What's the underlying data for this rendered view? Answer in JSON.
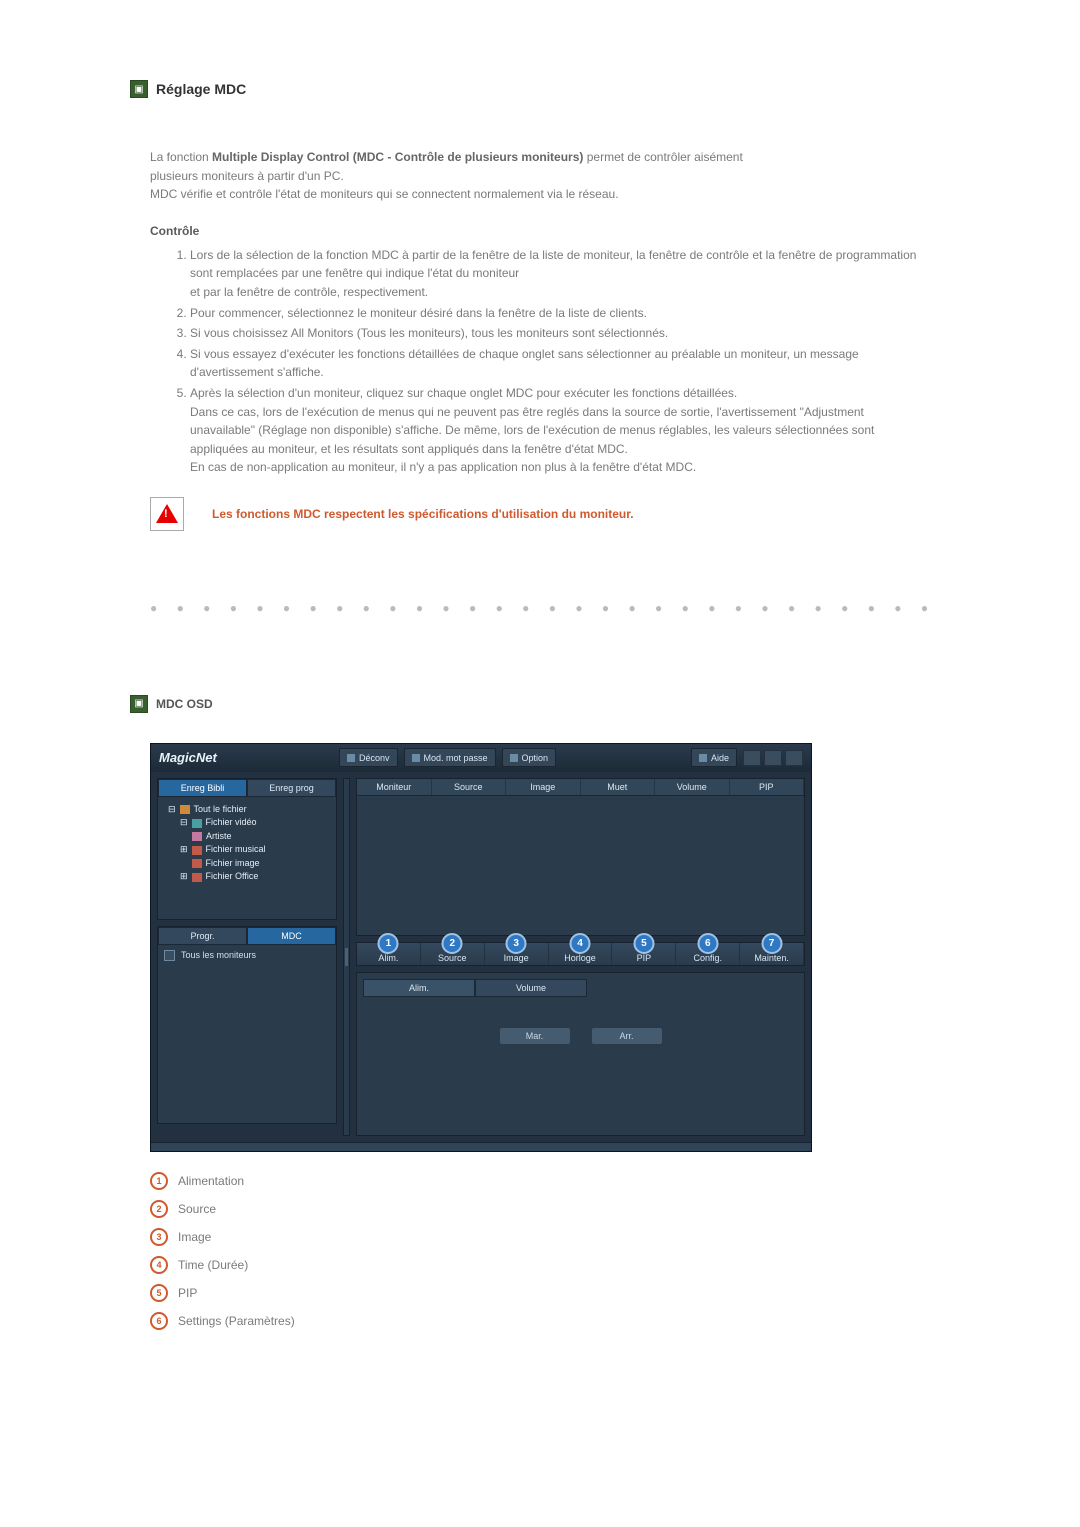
{
  "header": {
    "title": "Réglage MDC"
  },
  "intro": {
    "prefix": "La fonction ",
    "bold": "Multiple Display Control (MDC - Contrôle de plusieurs moniteurs)",
    "suffix": " permet de contrôler aisément",
    "line2": "plusieurs moniteurs à partir d'un PC.",
    "line3": "MDC vérifie et contrôle l'état de moniteurs qui se connectent normalement via le réseau."
  },
  "controle": {
    "heading": "Contrôle",
    "items": [
      "Lors de la sélection de la fonction MDC à partir de la fenêtre de la liste de moniteur, la fenêtre de contrôle et la fenêtre de programmation sont remplacées par une fenêtre qui indique l'état du moniteur\net par la fenêtre de contrôle, respectivement.",
      "Pour commencer, sélectionnez le moniteur désiré dans la fenêtre de la liste de clients.",
      "Si vous choisissez All Monitors (Tous les moniteurs), tous les moniteurs sont sélectionnés.",
      "Si vous essayez d'exécuter les fonctions détaillées de chaque onglet sans sélectionner au préalable un moniteur, un message d'avertissement s'affiche.",
      "Après la sélection d'un moniteur, cliquez sur chaque onglet MDC pour exécuter les fonctions détaillées.\nDans ce cas, lors de l'exécution de menus qui ne peuvent pas être reglés dans la source de sortie, l'avertissement \"Adjustment unavailable\" (Réglage non disponible) s'affiche. De même, lors de l'exécution de menus réglables, les valeurs sélectionnées sont appliquées au moniteur, et les résultats sont appliqués dans la fenêtre d'état MDC.\nEn cas de non-application au moniteur, il n'y a pas application non plus à la fenêtre d'état MDC."
    ]
  },
  "warning": "Les fonctions MDC respectent les spécifications d'utilisation du moniteur.",
  "osd_header": "MDC OSD",
  "magicnet": {
    "logo": "MagicNet",
    "top_buttons": {
      "deconv": "Déconv",
      "modpasse": "Mod. mot passe",
      "option": "Option",
      "aide": "Aide"
    },
    "left": {
      "tabs": {
        "bibli": "Enreg Bibli",
        "prog": "Enreg prog"
      },
      "tree": {
        "root": "Tout le fichier",
        "video": "Fichier vidéo",
        "artiste": "Artiste",
        "musical": "Fichier musical",
        "image": "Fichier image",
        "office": "Fichier Office"
      },
      "mini_tabs": {
        "progr": "Progr.",
        "mdc": "MDC"
      },
      "list_item": "Tous les moniteurs"
    },
    "grid_headers": {
      "moniteur": "Moniteur",
      "source": "Source",
      "image": "Image",
      "muet": "Muet",
      "volume": "Volume",
      "pip": "PIP"
    },
    "tabs": {
      "t1": "Alim.",
      "t2": "Source",
      "t3": "Image",
      "t4": "Horloge",
      "t5": "PIP",
      "t6": "Config.",
      "t7": "Mainten."
    },
    "ctrl": {
      "tab_alim": "Alim.",
      "tab_volume": "Volume",
      "btn_mar": "Mar.",
      "btn_arr": "Arr."
    }
  },
  "legend": [
    {
      "n": "1",
      "label": "Alimentation"
    },
    {
      "n": "2",
      "label": "Source"
    },
    {
      "n": "3",
      "label": "Image"
    },
    {
      "n": "4",
      "label": "Time (Durée)"
    },
    {
      "n": "5",
      "label": "PIP"
    },
    {
      "n": "6",
      "label": "Settings (Paramètres)"
    }
  ]
}
